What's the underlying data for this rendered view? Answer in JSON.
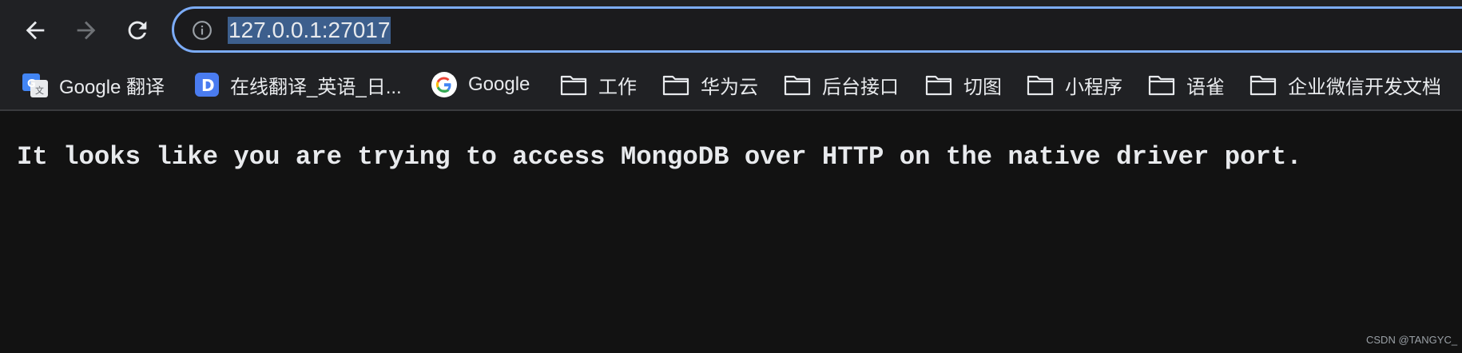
{
  "browser": {
    "address_bar": {
      "url": "127.0.0.1:27017",
      "icon": "info-icon"
    },
    "nav": {
      "back_icon": "arrow-left-icon",
      "forward_icon": "arrow-right-icon",
      "reload_icon": "reload-icon"
    },
    "bookmarks": [
      {
        "label": "Google 翻译",
        "icon": "google-translate-icon"
      },
      {
        "label": "在线翻译_英语_日...",
        "icon": "deepl-d-icon"
      },
      {
        "label": "Google",
        "icon": "google-g-icon"
      },
      {
        "label": "工作",
        "icon": "folder-icon"
      },
      {
        "label": "华为云",
        "icon": "folder-icon"
      },
      {
        "label": "后台接口",
        "icon": "folder-icon"
      },
      {
        "label": "切图",
        "icon": "folder-icon"
      },
      {
        "label": "小程序",
        "icon": "folder-icon"
      },
      {
        "label": "语雀",
        "icon": "folder-icon"
      },
      {
        "label": "企业微信开发文档",
        "icon": "folder-icon"
      }
    ]
  },
  "page": {
    "message": "It looks like you are trying to access MongoDB over HTTP on the native driver port."
  },
  "watermark": "CSDN @TANGYC_",
  "colors": {
    "toolbar_bg": "#202124",
    "page_bg": "#121212",
    "omnibox_border": "#7cacf8",
    "url_selection": "#3d5f8d",
    "text": "#e8eaed"
  }
}
